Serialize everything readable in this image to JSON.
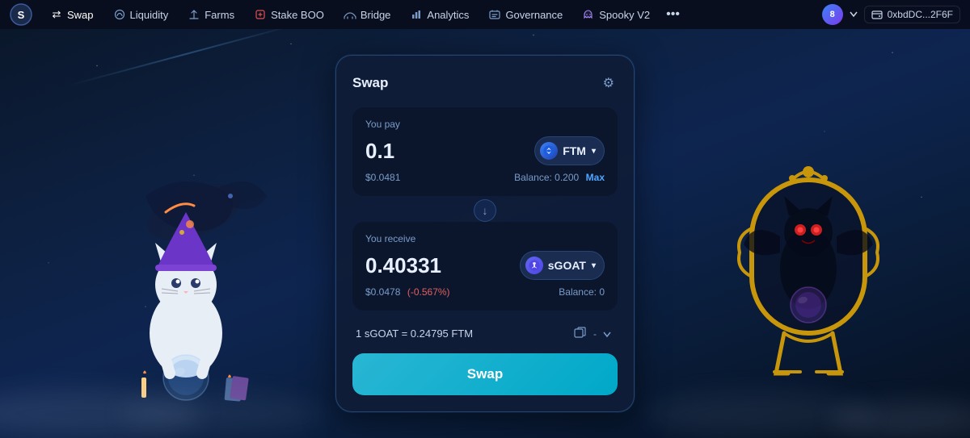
{
  "app": {
    "logo_text": "S"
  },
  "navbar": {
    "items": [
      {
        "id": "swap",
        "label": "Swap",
        "icon": "⇄",
        "active": true
      },
      {
        "id": "liquidity",
        "label": "Liquidity",
        "icon": "💧"
      },
      {
        "id": "farms",
        "label": "Farms",
        "icon": "🌾"
      },
      {
        "id": "stake-boo",
        "label": "Stake BOO",
        "icon": "🔪"
      },
      {
        "id": "bridge",
        "label": "Bridge",
        "icon": "🌉"
      },
      {
        "id": "analytics",
        "label": "Analytics",
        "icon": "📊"
      },
      {
        "id": "governance",
        "label": "Governance",
        "icon": "📋"
      },
      {
        "id": "spooky-v2",
        "label": "Spooky V2",
        "icon": "👻"
      }
    ],
    "more_label": "•••",
    "wallet_address": "0xbdDC...2F6F"
  },
  "swap_card": {
    "title": "Swap",
    "settings_icon": "⚙",
    "you_pay_label": "You pay",
    "pay_amount": "0.1",
    "pay_token": "FTM",
    "pay_usd": "$0.0481",
    "pay_balance_label": "Balance:",
    "pay_balance_value": "0.200",
    "pay_max_label": "Max",
    "arrow_icon": "↓",
    "you_receive_label": "You receive",
    "receive_amount": "0.40331",
    "receive_token": "sGOAT",
    "receive_usd": "$0.0478",
    "receive_diff": "(-0.567%)",
    "receive_balance_label": "Balance:",
    "receive_balance_value": "0",
    "price_info": "1 sGOAT = 0.24795 FTM",
    "swap_button_label": "Swap"
  },
  "colors": {
    "accent_blue": "#29b6d4",
    "nav_bg": "#080e1c",
    "card_bg": "#0f1c37",
    "text_primary": "#e8f0ff",
    "text_secondary": "#7a9cc8",
    "max_color": "#4da6ff",
    "negative_color": "#e06060"
  }
}
